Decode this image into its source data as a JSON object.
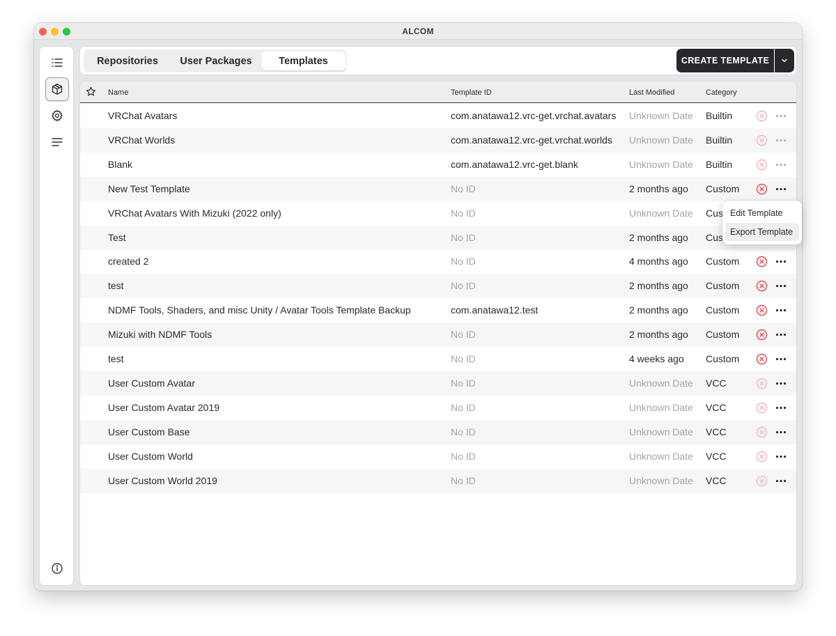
{
  "window": {
    "title": "ALCOM"
  },
  "sidebar": {
    "items": [
      {
        "name": "projects",
        "icon": "list-icon"
      },
      {
        "name": "packages",
        "icon": "package-icon",
        "active": true
      },
      {
        "name": "settings",
        "icon": "gear-icon"
      },
      {
        "name": "logs",
        "icon": "lines-icon"
      }
    ],
    "footer_icon": "info-icon"
  },
  "tabs": [
    {
      "label": "Repositories"
    },
    {
      "label": "User Packages"
    },
    {
      "label": "Templates",
      "active": true
    }
  ],
  "actions": {
    "create_label": "CREATE TEMPLATE"
  },
  "table": {
    "columns": {
      "name": "Name",
      "id": "Template ID",
      "modified": "Last Modified",
      "category": "Category"
    },
    "rows": [
      {
        "name": "VRChat Avatars",
        "id": "com.anatawa12.vrc-get.vrchat.avatars",
        "modified": "Unknown Date",
        "category": "Builtin"
      },
      {
        "name": "VRChat Worlds",
        "id": "com.anatawa12.vrc-get.vrchat.worlds",
        "modified": "Unknown Date",
        "category": "Builtin"
      },
      {
        "name": "Blank",
        "id": "com.anatawa12.vrc-get.blank",
        "modified": "Unknown Date",
        "category": "Builtin"
      },
      {
        "name": "New Test Template",
        "id": "No ID",
        "modified": "2 months ago",
        "category": "Custom"
      },
      {
        "name": "VRChat Avatars With Mizuki (2022 only)",
        "id": "No ID",
        "modified": "Unknown Date",
        "category": "Cus"
      },
      {
        "name": "Test",
        "id": "No ID",
        "modified": "2 months ago",
        "category": "Cus"
      },
      {
        "name": "created 2",
        "id": "No ID",
        "modified": "4 months ago",
        "category": "Custom"
      },
      {
        "name": "test",
        "id": "No ID",
        "modified": "2 months ago",
        "category": "Custom"
      },
      {
        "name": "NDMF Tools, Shaders, and misc Unity / Avatar Tools Template Backup",
        "id": "com.anatawa12.test",
        "modified": "2 months ago",
        "category": "Custom"
      },
      {
        "name": "Mizuki with NDMF Tools",
        "id": "No ID",
        "modified": "2 months ago",
        "category": "Custom"
      },
      {
        "name": "test",
        "id": "No ID",
        "modified": "4 weeks ago",
        "category": "Custom"
      },
      {
        "name": "User Custom Avatar",
        "id": "No ID",
        "modified": "Unknown Date",
        "category": "VCC"
      },
      {
        "name": "User Custom Avatar 2019",
        "id": "No ID",
        "modified": "Unknown Date",
        "category": "VCC"
      },
      {
        "name": "User Custom Base",
        "id": "No ID",
        "modified": "Unknown Date",
        "category": "VCC"
      },
      {
        "name": "User Custom World",
        "id": "No ID",
        "modified": "Unknown Date",
        "category": "VCC"
      },
      {
        "name": "User Custom World 2019",
        "id": "No ID",
        "modified": "Unknown Date",
        "category": "VCC"
      }
    ]
  },
  "context_menu": {
    "items": [
      {
        "label": "Edit Template"
      },
      {
        "label": "Export Template",
        "hover": true
      }
    ]
  },
  "colors": {
    "accent_dark": "#26282b",
    "danger": "#e5484d",
    "danger_muted": "#f3b4b6"
  }
}
